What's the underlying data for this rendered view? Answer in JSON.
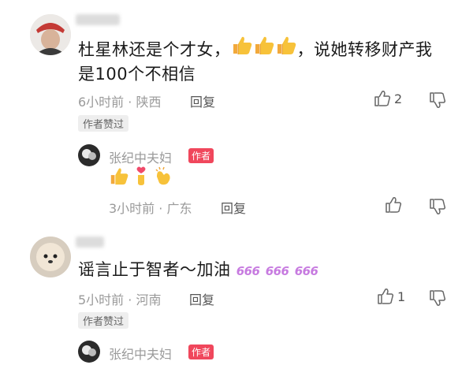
{
  "comments": [
    {
      "text_line1": "杜星林还是个才女，",
      "emoji_after_line1": [
        "thumbs-up",
        "thumbs-up",
        "thumbs-up"
      ],
      "text_line1_tail": "，说她转移财产我",
      "text_line2": "是100个不相信",
      "time_location": "6小时前 · 陕西",
      "reply_label": "回复",
      "like_count": "2",
      "author_liked_tag": "作者赞过",
      "reply": {
        "name": "张纪中夫妇",
        "badge": "作者",
        "emojis": [
          "thumbs-up",
          "finger-heart",
          "clapping-hands"
        ],
        "time_location": "3小时前 · 广东",
        "reply_label": "回复"
      }
    },
    {
      "text": "谣言止于智者～加油",
      "emoji_after": [
        "666",
        "666",
        "666"
      ],
      "emoji_label": "666",
      "time_location": "5小时前 · 河南",
      "reply_label": "回复",
      "like_count": "1",
      "author_liked_tag": "作者赞过",
      "reply": {
        "name": "张纪中夫妇",
        "badge": "作者"
      }
    }
  ],
  "colors": {
    "badge": "#f0475c",
    "meta": "#9a9a9a",
    "emoji_666": "#c77be0"
  }
}
